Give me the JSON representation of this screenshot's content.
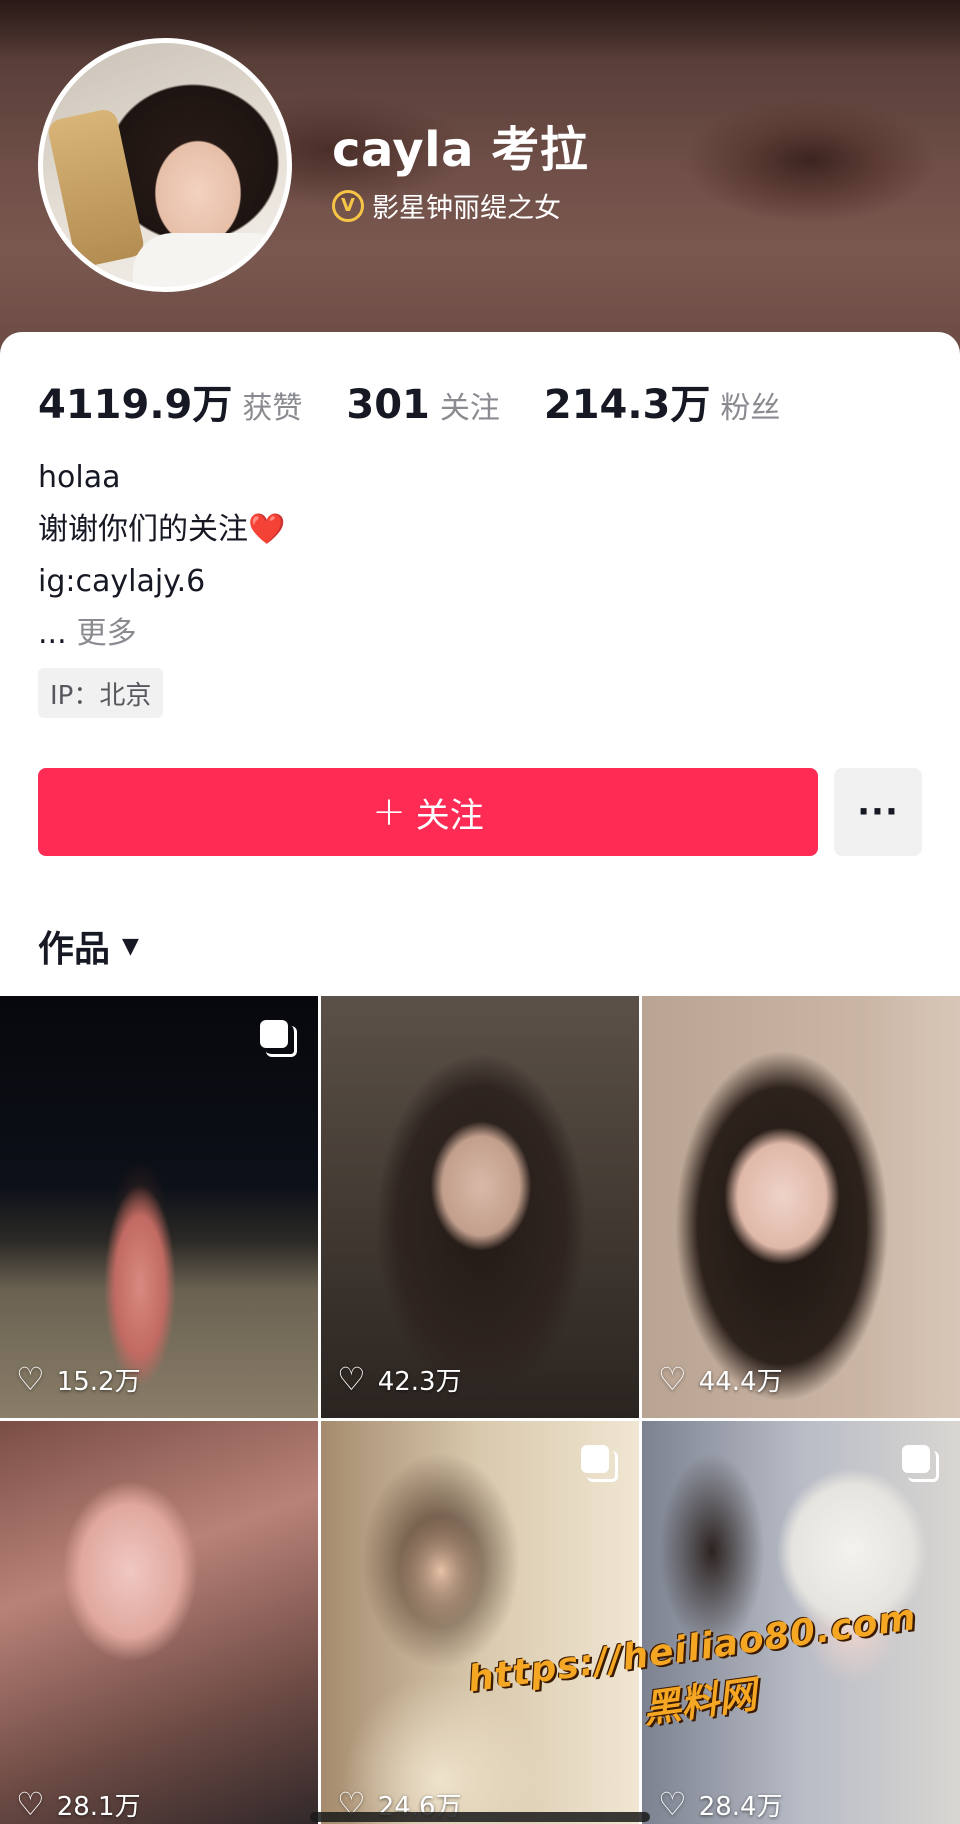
{
  "profile": {
    "username": "cayla 考拉",
    "verification_label": "影星钟丽缇之女",
    "verification_icon": "verified-v-icon"
  },
  "stats": [
    {
      "value": "4119.9万",
      "label": "获赞"
    },
    {
      "value": "301",
      "label": "关注"
    },
    {
      "value": "214.3万",
      "label": "粉丝"
    }
  ],
  "bio": {
    "line1": "holaa",
    "line2": "谢谢你们的关注❤️",
    "line3": "ig:caylajy.6",
    "ellipsis": "...",
    "more_label": "更多"
  },
  "ip_tag": "IP：北京",
  "actions": {
    "follow_plus": "+",
    "follow_label": "关注",
    "more_label": "···"
  },
  "works_tab": {
    "label": "作品",
    "caret": "▼"
  },
  "posts": [
    {
      "likes": "15.2万",
      "multi_image": true
    },
    {
      "likes": "42.3万",
      "multi_image": false
    },
    {
      "likes": "44.4万",
      "multi_image": false
    },
    {
      "likes": "28.1万",
      "multi_image": false
    },
    {
      "likes": "24.6万",
      "multi_image": true
    },
    {
      "likes": "28.4万",
      "multi_image": true
    }
  ],
  "icons": {
    "heart": "♡"
  },
  "watermark": {
    "url": "https://heiliao80.com",
    "text": "黑料网"
  },
  "colors": {
    "follow_button": "#fe2c55",
    "verify_badge": "#f7c546",
    "secondary_text": "#8a8b91"
  }
}
